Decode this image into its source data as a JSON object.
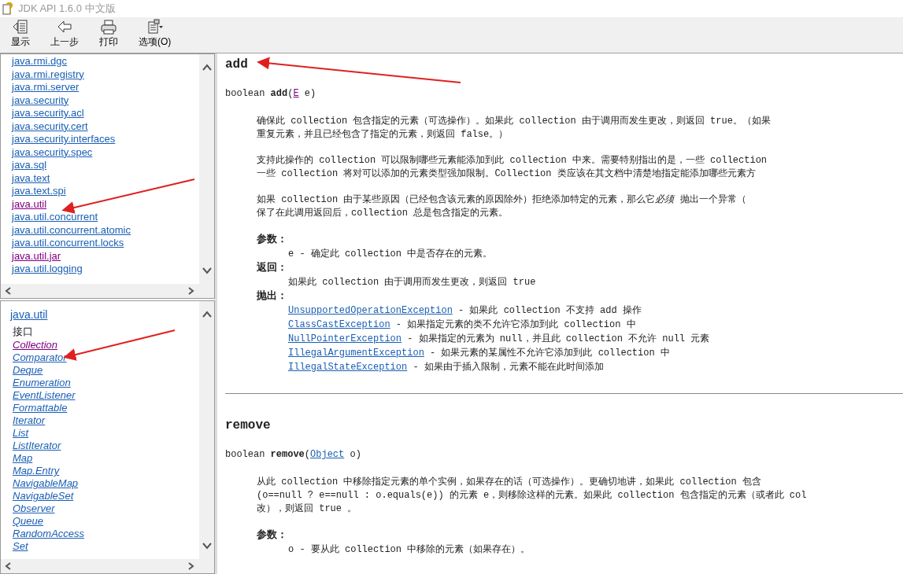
{
  "window": {
    "title": "JDK API 1.6.0 中文版"
  },
  "toolbar": [
    {
      "kind": "show",
      "label": "显示"
    },
    {
      "kind": "back",
      "label": "上一步"
    },
    {
      "kind": "print",
      "label": "打印"
    },
    {
      "kind": "options",
      "label": "选项(O)"
    }
  ],
  "package_list": [
    {
      "label": "java.rmi.dgc",
      "visited": false
    },
    {
      "label": "java.rmi.registry",
      "visited": false
    },
    {
      "label": "java.rmi.server",
      "visited": false
    },
    {
      "label": "java.security",
      "visited": false
    },
    {
      "label": "java.security.acl",
      "visited": false
    },
    {
      "label": "java.security.cert",
      "visited": false
    },
    {
      "label": "java.security.interfaces",
      "visited": false
    },
    {
      "label": "java.security.spec",
      "visited": false
    },
    {
      "label": "java.sql",
      "visited": false
    },
    {
      "label": "java.text",
      "visited": false
    },
    {
      "label": "java.text.spi",
      "visited": false
    },
    {
      "label": "java.util",
      "visited": true
    },
    {
      "label": "java.util.concurrent",
      "visited": false
    },
    {
      "label": "java.util.concurrent.atomic",
      "visited": false
    },
    {
      "label": "java.util.concurrent.locks",
      "visited": false
    },
    {
      "label": "java.util.jar",
      "visited": true
    },
    {
      "label": "java.util.logging",
      "visited": false
    }
  ],
  "class_list": {
    "package": "java.util",
    "heading": "接口",
    "items": [
      {
        "label": "Collection",
        "visited": true
      },
      {
        "label": "Comparator",
        "visited": false
      },
      {
        "label": "Deque",
        "visited": false
      },
      {
        "label": "Enumeration",
        "visited": false
      },
      {
        "label": "EventListener",
        "visited": false
      },
      {
        "label": "Formattable",
        "visited": false
      },
      {
        "label": "Iterator",
        "visited": false
      },
      {
        "label": "List",
        "visited": false
      },
      {
        "label": "ListIterator",
        "visited": false
      },
      {
        "label": "Map",
        "visited": false
      },
      {
        "label": "Map.Entry",
        "visited": false
      },
      {
        "label": "NavigableMap",
        "visited": false
      },
      {
        "label": "NavigableSet",
        "visited": false
      },
      {
        "label": "Observer",
        "visited": false
      },
      {
        "label": "Queue",
        "visited": false
      },
      {
        "label": "RandomAccess",
        "visited": false
      },
      {
        "label": "Set",
        "visited": false
      }
    ]
  },
  "methods": [
    {
      "name": "add",
      "signature": {
        "before": "boolean **add**(",
        "link": "E",
        "link_visited": true,
        "after": " e)"
      },
      "paragraphs": [
        [
          "确保此 collection 包含指定的元素（可选操作）。如果此 collection 由于调用而发生更改，则返回 true。（如果",
          "重复元素，并且已经包含了指定的元素，则返回 false。）"
        ],
        [
          "支持此操作的 collection 可以限制哪些元素能添加到此 collection 中来。需要特别指出的是，一些 collection",
          "一些 collection 将对可以添加的元素类型强加限制。Collection 类应该在其文档中清楚地指定能添加哪些元素方"
        ],
        [
          {
            "parts": [
              {
                "text": "如果 collection 由于某些原因（已经包含该元素的原因除外）拒绝添加特定的元素，那么它",
                "italic": false
              },
              {
                "text": "必须",
                "italic": true
              },
              {
                "text": " 抛出一个异常（",
                "italic": false
              }
            ]
          },
          "保了在此调用返回后，collection 总是包含指定的元素。"
        ]
      ],
      "sections": [
        {
          "label": "参数：",
          "entries": [
            {
              "text": "e - 确定此 collection 中是否存在的元素。"
            }
          ]
        },
        {
          "label": "返回：",
          "entries": [
            {
              "text": "如果此 collection 由于调用而发生更改，则返回 true"
            }
          ]
        },
        {
          "label": "抛出：",
          "entries": [
            {
              "link": "UnsupportedOperationException",
              "text": " - 如果此 collection 不支持 add 操作"
            },
            {
              "link": "ClassCastException",
              "text": " - 如果指定元素的类不允许它添加到此 collection 中"
            },
            {
              "link": "NullPointerException",
              "text": " - 如果指定的元素为 null，并且此 collection 不允许 null 元素"
            },
            {
              "link": "IllegalArgumentException",
              "text": " - 如果元素的某属性不允许它添加到此 collection 中"
            },
            {
              "link": "IllegalStateException",
              "text": " - 如果由于插入限制，元素不能在此时间添加"
            }
          ]
        }
      ]
    },
    {
      "name": "remove",
      "signature": {
        "before": "boolean **remove**(",
        "link": "Object",
        "link_visited": false,
        "after": " o)"
      },
      "paragraphs": [
        [
          "从此 collection 中移除指定元素的单个实例，如果存在的话（可选操作）。更确切地讲，如果此 collection 包含",
          "(o==null ? e==null : o.equals(e)) 的元素 e，则移除这样的元素。如果此 collection 包含指定的元素（或者此 col",
          "改），则返回 true 。"
        ]
      ],
      "sections": [
        {
          "label": "参数：",
          "entries": [
            {
              "text": "o - 要从此 collection 中移除的元素（如果存在）。"
            }
          ]
        }
      ]
    }
  ]
}
